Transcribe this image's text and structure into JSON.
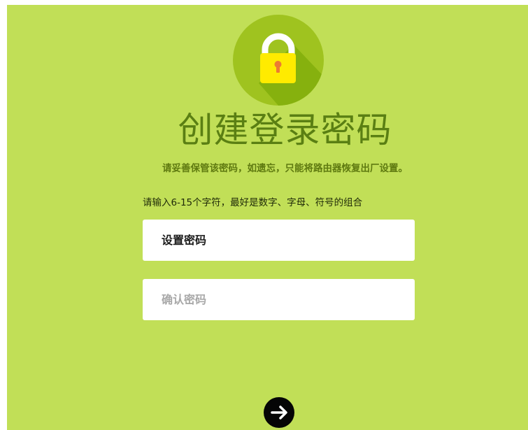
{
  "colors": {
    "background": "#c1df57",
    "accent": "#5a7f13",
    "lock_circle": "#9fc31f",
    "lock_body": "#ffeb00"
  },
  "icons": {
    "header": "lock-icon",
    "submit": "arrow-right-icon"
  },
  "header": {
    "title": "创建登录密码",
    "warning": "请妥善保管该密码，如遗忘，只能将路由器恢复出厂设置。"
  },
  "form": {
    "hint": "请输入6-15个字符，最好是数字、字母、符号的组合",
    "password_placeholder": "设置密码",
    "confirm_placeholder": "确认密码"
  }
}
